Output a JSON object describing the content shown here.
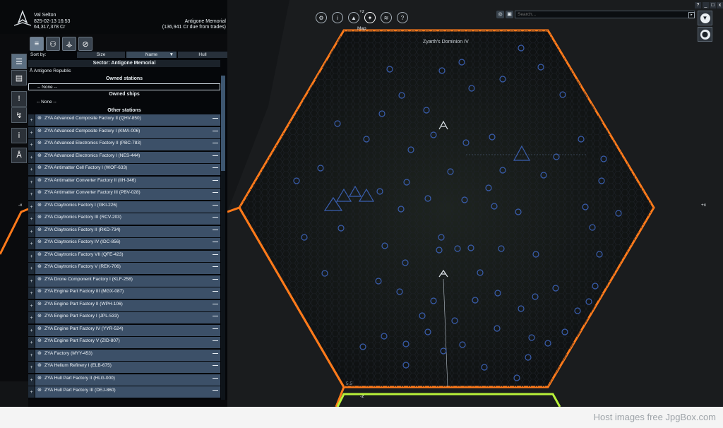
{
  "player": {
    "name": "Val Selton",
    "datetime": "825-02-13 16:53",
    "credits": "64,317,378 Cr",
    "sector_name": "Antigone Memorial",
    "credits_due": "(136,941 Cr due from trades)"
  },
  "toolbar": {
    "map_label": "Map",
    "plus_z_top": "+z",
    "plus_z_bottom": "-z",
    "minus_x": "-x",
    "plus_x": "+x"
  },
  "search": {
    "placeholder": "Search..."
  },
  "window": {
    "help": "?",
    "minimize": "_",
    "restore": "□",
    "close": "x"
  },
  "map": {
    "sector_label": "Zyarth's Dominion IV",
    "scale_label": "5.5"
  },
  "panel": {
    "sort_by": "Sort by:",
    "sort_columns": [
      "Size",
      "Name",
      "Hull"
    ],
    "sector_title": "Sector: Antigone Memorial",
    "faction": "Antigone Republic",
    "owned_stations": "Owned stations",
    "owned_stations_none": "-- None --",
    "owned_ships": "Owned ships",
    "owned_ships_none": "-- None --",
    "other_stations": "Other stations",
    "stations": [
      "ZYA Advanced Composite Factory II (QHV-850)",
      "ZYA Advanced Composite Factory I (KMA-006)",
      "ZYA Advanced Electronics Factory II (PBC-783)",
      "ZYA Advanced Electronics Factory I (NES-444)",
      "ZYA Antimatter Cell Factory I (WOF-633)",
      "ZYA Antimatter Converter Factory II (IIH-346)",
      "ZYA Antimatter Converter Factory III (PBV-028)",
      "ZYA Claytronics Factory I (GKI-226)",
      "ZYA Claytronics Factory III (RCV-203)",
      "ZYA Claytronics Factory II (RKD-734)",
      "ZYA Claytronics Factory IV (IDC-856)",
      "ZYA Claytronics Factory VII (QFE-423)",
      "ZYA Claytronics Factory V (REK-706)",
      "ZYA Drone Component Factory I (KLF-258)",
      "ZYA Engine Part Factory III (MGX-087)",
      "ZYA Engine Part Factory II (WPH-106)",
      "ZYA Engine Part Factory I (JPL-533)",
      "ZYA Engine Part Factory IV (YYR-524)",
      "ZYA Engine Part Factory V (ZID-807)",
      "ZYA Factory (MYY-453)",
      "ZYA Helium Refinery I (ELB-675)",
      "ZYA Hull Part Factory II (HLG-000)",
      "ZYA Hull Part Factory III (DEJ-860)"
    ]
  },
  "footer": {
    "text": "Host images free JpgBox.com"
  },
  "colors": {
    "accent_orange": "#ff7a1a",
    "accent_green": "#b8f03a",
    "row_blue": "#3c5068"
  },
  "icons": {
    "side": [
      "list-icon",
      "property-owned-icon",
      "alert-icon",
      "trade-icon",
      "info-icon",
      "faction-icon"
    ],
    "tabs": [
      "list-icon",
      "people-icon",
      "filter-icon",
      "blocked-icon"
    ],
    "top": [
      "gear-icon",
      "info-icon",
      "ship-icon",
      "map-icon",
      "layers-icon",
      "help-icon"
    ],
    "right": [
      "filter-funnel-icon",
      "location-pin-icon"
    ]
  }
}
